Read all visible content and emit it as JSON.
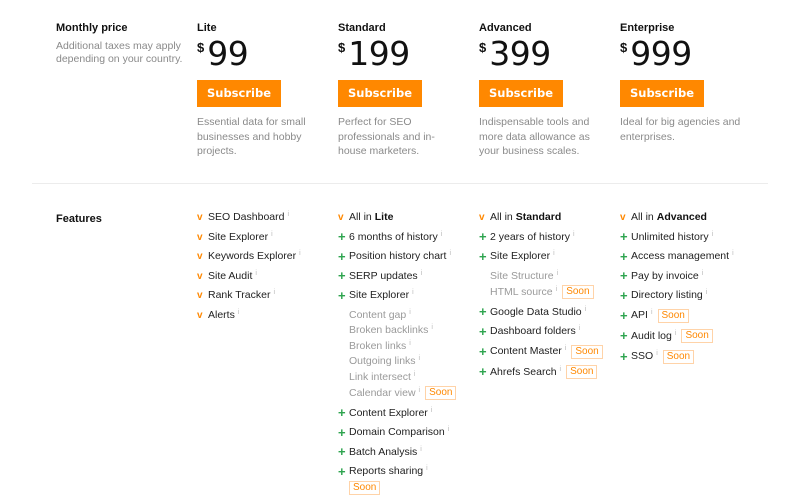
{
  "pricing": {
    "label_title": "Monthly price",
    "label_note": "Additional taxes may apply depending on your country.",
    "currency": "$",
    "subscribe_label": "Subscribe",
    "plans": [
      {
        "name": "Lite",
        "price": "99",
        "description": "Essential data for small businesses and hobby projects."
      },
      {
        "name": "Standard",
        "price": "199",
        "description": "Perfect for SEO professionals and in-house marketers."
      },
      {
        "name": "Advanced",
        "price": "399",
        "description": "Indispensable tools and more data allowance as your business scales."
      },
      {
        "name": "Enterprise",
        "price": "999",
        "description": "Ideal for big agencies and enterprises."
      }
    ]
  },
  "features": {
    "title": "Features",
    "soon_label": "Soon",
    "info_icon": "info-icon",
    "colors": {
      "accent": "#ff8800",
      "plus": "#2ea44f"
    },
    "all_in_prefix": "All in",
    "columns": [
      {
        "items": [
          {
            "icon": "check",
            "label": "SEO Dashboard"
          },
          {
            "icon": "check",
            "label": "Site Explorer"
          },
          {
            "icon": "check",
            "label": "Keywords Explorer"
          },
          {
            "icon": "check",
            "label": "Site Audit"
          },
          {
            "icon": "check",
            "label": "Rank Tracker"
          },
          {
            "icon": "check",
            "label": "Alerts"
          }
        ]
      },
      {
        "all_in": "Lite",
        "items": [
          {
            "icon": "plus",
            "label": "6 months of history"
          },
          {
            "icon": "plus",
            "label": "Position history chart"
          },
          {
            "icon": "plus",
            "label": "SERP updates"
          },
          {
            "icon": "plus",
            "label": "Site Explorer"
          },
          {
            "icon": "sub",
            "label": "Content gap"
          },
          {
            "icon": "sub",
            "label": "Broken backlinks"
          },
          {
            "icon": "sub",
            "label": "Broken links"
          },
          {
            "icon": "sub",
            "label": "Outgoing links"
          },
          {
            "icon": "sub",
            "label": "Link intersect"
          },
          {
            "icon": "sub",
            "label": "Calendar view",
            "soon": true
          },
          {
            "icon": "plus",
            "label": "Content Explorer"
          },
          {
            "icon": "plus",
            "label": "Domain Comparison"
          },
          {
            "icon": "plus",
            "label": "Batch Analysis"
          },
          {
            "icon": "plus",
            "label": "Reports sharing",
            "soon": true,
            "soon_below": true
          }
        ]
      },
      {
        "all_in": "Standard",
        "items": [
          {
            "icon": "plus",
            "label": "2 years of history"
          },
          {
            "icon": "plus",
            "label": "Site Explorer"
          },
          {
            "icon": "sub",
            "label": "Site Structure"
          },
          {
            "icon": "sub",
            "label": "HTML source",
            "soon": true
          },
          {
            "icon": "plus",
            "label": "Google Data Studio"
          },
          {
            "icon": "plus",
            "label": "Dashboard folders"
          },
          {
            "icon": "plus",
            "label": "Content Master",
            "soon": true
          },
          {
            "icon": "plus",
            "label": "Ahrefs Search",
            "soon": true
          }
        ]
      },
      {
        "all_in": "Advanced",
        "items": [
          {
            "icon": "plus",
            "label": "Unlimited history"
          },
          {
            "icon": "plus",
            "label": "Access management"
          },
          {
            "icon": "plus",
            "label": "Pay by invoice"
          },
          {
            "icon": "plus",
            "label": "Directory listing"
          },
          {
            "icon": "plus",
            "label": "API",
            "soon": true
          },
          {
            "icon": "plus",
            "label": "Audit log",
            "soon": true
          },
          {
            "icon": "plus",
            "label": "SSO",
            "soon": true
          }
        ]
      }
    ]
  }
}
